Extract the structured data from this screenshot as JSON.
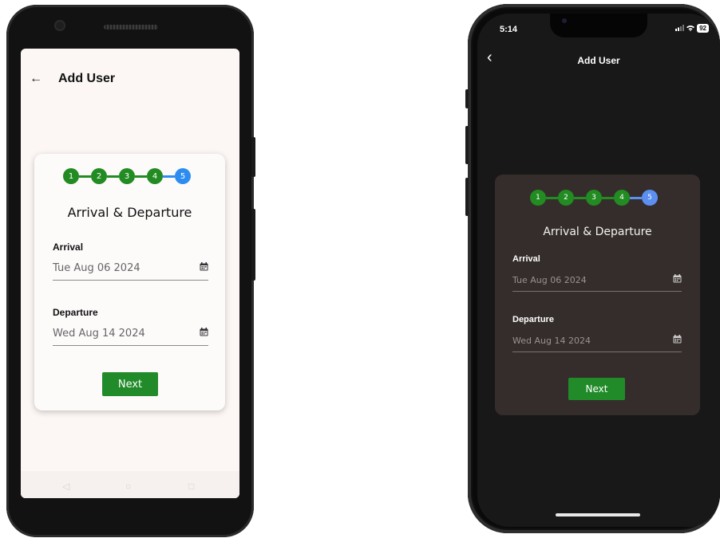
{
  "light": {
    "title": "Add User",
    "back_icon": "arrow-left-icon",
    "steps": [
      "1",
      "2",
      "3",
      "4",
      "5"
    ],
    "heading": "Arrival & Departure",
    "arrival_label": "Arrival",
    "arrival_value": "Tue Aug 06 2024",
    "departure_label": "Departure",
    "departure_value": "Wed Aug 14 2024",
    "next_label": "Next"
  },
  "dark": {
    "status_time": "5:14",
    "battery": "92",
    "title": "Add User",
    "back_icon": "chevron-left-icon",
    "steps": [
      "1",
      "2",
      "3",
      "4",
      "5"
    ],
    "heading": "Arrival & Departure",
    "arrival_label": "Arrival",
    "arrival_value": "Tue Aug 06 2024",
    "departure_label": "Departure",
    "departure_value": "Wed Aug 14 2024",
    "next_label": "Next"
  },
  "colors": {
    "done_step": "#228b22",
    "active_step_light": "#2d8cf0",
    "active_step_dark": "#5b8ff0",
    "next_button": "#218b2a",
    "dark_card": "#352d2b"
  }
}
